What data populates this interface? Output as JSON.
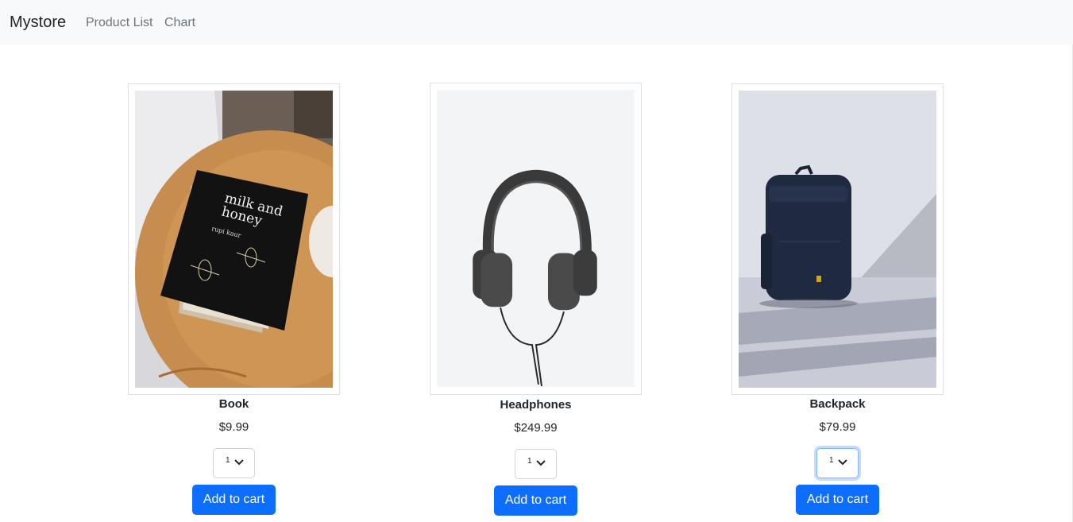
{
  "navbar": {
    "brand": "Mystore",
    "links": [
      "Product List",
      "Chart"
    ]
  },
  "products": [
    {
      "name": "Book",
      "price": "$9.99",
      "quantity": "1",
      "button": "Add to cart",
      "image": "book-photo",
      "cover_text": [
        "milk and",
        "honey",
        "rupi kaur"
      ]
    },
    {
      "name": "Headphones",
      "price": "$249.99",
      "quantity": "1",
      "button": "Add to cart",
      "image": "headphones-photo"
    },
    {
      "name": "Backpack",
      "price": "$79.99",
      "quantity": "1",
      "button": "Add to cart",
      "image": "backpack-photo"
    }
  ],
  "colors": {
    "navbar_bg": "#f8f9fa",
    "button_primary": "#0d6efd",
    "focus_ring": "#86b7fe"
  }
}
